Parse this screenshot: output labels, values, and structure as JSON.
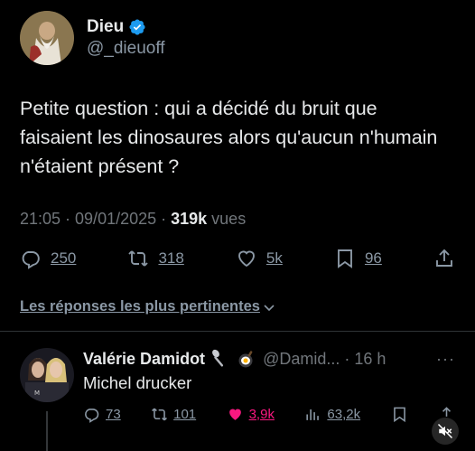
{
  "author": {
    "name": "Dieu",
    "handle": "@_dieuoff"
  },
  "tweet": {
    "text": "Petite question : qui a décidé du bruit que faisaient les dinosaures alors qu'aucun n'humain n'étaient présent ?",
    "time": "21:05 · 09/01/2025 · ",
    "views_count": "319k",
    "views_label": " vues"
  },
  "actions": {
    "replies": "250",
    "retweets": "318",
    "likes": "5k",
    "bookmarks": "96"
  },
  "replies_filter": "Les réponses les plus pertinentes",
  "reply": {
    "name": "Valérie Damidot",
    "handle": "@Damid...",
    "time": "· 16 h",
    "more": "···",
    "text": "Michel drucker",
    "replies": "73",
    "retweets": "101",
    "likes": "3,9k",
    "views": "63,2k"
  },
  "colors": {
    "background": "#000000",
    "text": "#e7e9ea",
    "muted": "#71767b",
    "verified": "#1d9bf0",
    "like": "#f91880"
  },
  "icons": [
    "verified-badge-icon",
    "reply-icon",
    "retweet-icon",
    "like-icon",
    "bookmark-icon",
    "share-icon",
    "chevron-down-icon",
    "spoon-emoji-icon",
    "pan-emoji-icon",
    "views-icon",
    "mute-icon"
  ]
}
